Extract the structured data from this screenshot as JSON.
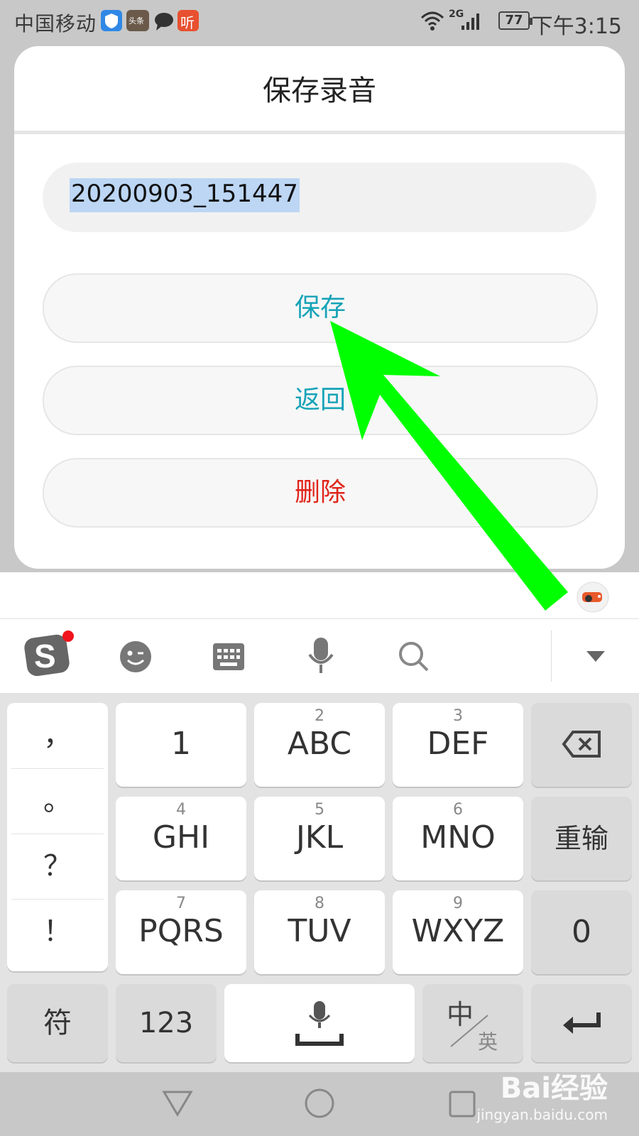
{
  "status_bar": {
    "carrier": "中国移动",
    "app_icon_label": "头条",
    "listen_icon_label": "听",
    "network": "2G",
    "battery": "77",
    "time": "下午3:15"
  },
  "dialog": {
    "title": "保存录音",
    "filename": "20200903_151447",
    "buttons": {
      "save": "保存",
      "back": "返回",
      "delete": "删除"
    },
    "colors": {
      "accent": "#16a3b8",
      "danger": "#e0241b"
    }
  },
  "annotation": {
    "arrow_color": "#00ff00"
  },
  "keyboard": {
    "punctuation": [
      "，",
      "。",
      "？",
      "！"
    ],
    "keys": [
      {
        "num": "",
        "label": "1"
      },
      {
        "num": "2",
        "label": "ABC"
      },
      {
        "num": "3",
        "label": "DEF"
      },
      {
        "num": "4",
        "label": "GHI"
      },
      {
        "num": "5",
        "label": "JKL"
      },
      {
        "num": "6",
        "label": "MNO"
      },
      {
        "num": "7",
        "label": "PQRS"
      },
      {
        "num": "8",
        "label": "TUV"
      },
      {
        "num": "9",
        "label": "WXYZ"
      }
    ],
    "reinput": "重输",
    "zero": "0",
    "symbols": "符",
    "numbers": "123",
    "lang_zh": "中",
    "lang_en": "英"
  },
  "watermark": {
    "brand": "Bai经验",
    "url": "jingyan.baidu.com"
  }
}
